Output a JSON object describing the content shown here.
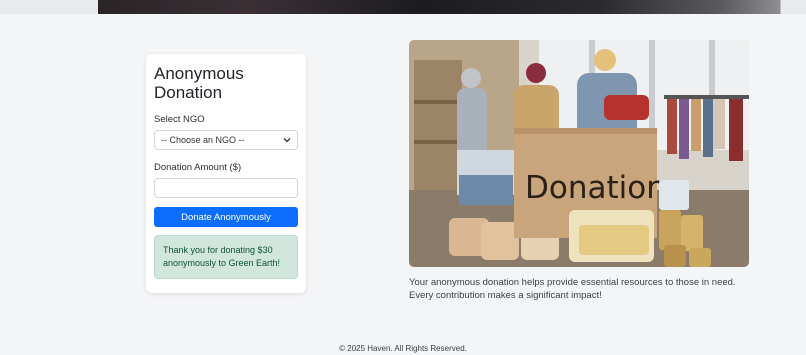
{
  "form": {
    "title": "Anonymous Donation",
    "ngo_label": "Select NGO",
    "ngo_selected": "-- Choose an NGO --",
    "amount_label": "Donation Amount ($)",
    "amount_value": "",
    "submit_label": "Donate Anonymously",
    "success_message": "Thank you for donating $30 anonymously to Green Earth!"
  },
  "image": {
    "box_text": "Donation"
  },
  "caption": {
    "text": "Your anonymous donation helps provide essential resources to those in need. Every contribution makes a significant impact!"
  },
  "footer": {
    "text": "© 2025 Haven. All Rights Reserved."
  },
  "colors": {
    "primary": "#0d6efd",
    "success_bg": "#d1e7dd",
    "success_text": "#0f5132",
    "page_bg": "#f4f5f7"
  },
  "icons": {
    "select_arrow": "chevron-down-icon"
  }
}
